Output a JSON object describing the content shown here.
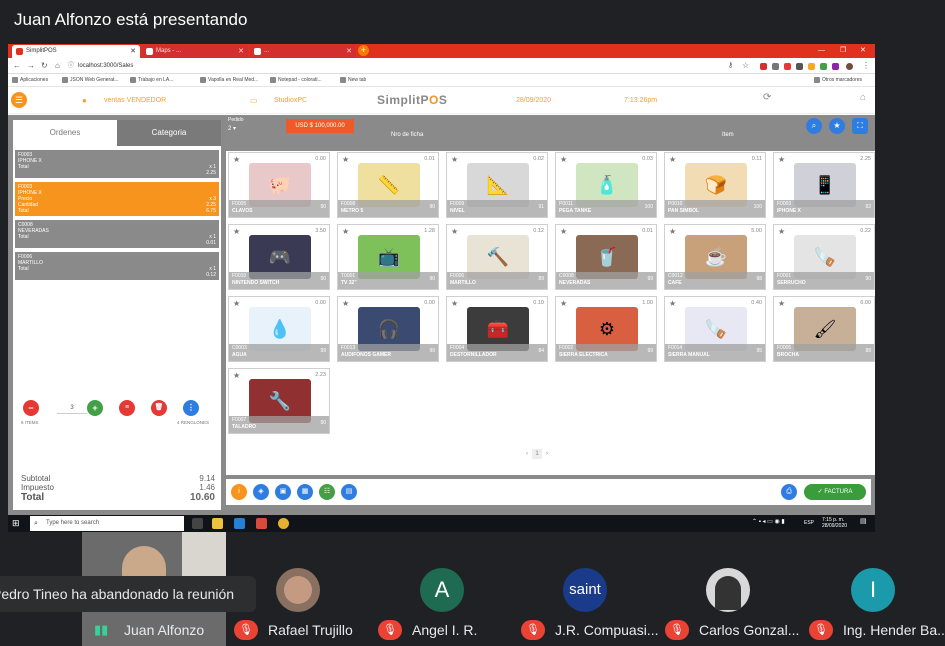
{
  "meet": {
    "presenting_title": "Juan Alfonzo está presentando",
    "notice": "Pedro Tineo ha abandonado la reunión",
    "participants": [
      {
        "name": "Juan Alfonzo",
        "muted": false
      },
      {
        "name": "Rafael Trujillo",
        "muted": true
      },
      {
        "name": "Angel I. R.",
        "muted": true,
        "initial": "A"
      },
      {
        "name": "J.R. Compuasi...",
        "muted": true,
        "initial": "saint"
      },
      {
        "name": "Carlos Gonzal...",
        "muted": true
      },
      {
        "name": "Ing. Hender Ba...",
        "muted": true,
        "initial": "I"
      }
    ]
  },
  "browser": {
    "tabs": [
      "SimplitPOS",
      "Maps - ...",
      "..."
    ],
    "url": "localhost:3000/Sales",
    "bookmarks": [
      "Aplicaciones",
      "JSON Web Generat...",
      "Trabajo en LA...",
      "Vapolla en Real Med...",
      "Notepad - colorati...",
      "New tab",
      "Otros marcadores"
    ]
  },
  "header": {
    "user": "ventas VENDEDOR",
    "station": "StudioxPC",
    "brand_pre": "SimplitP",
    "brand_o": "O",
    "brand_post": "S",
    "date": "28/09/2020",
    "time": "7:13:26pm"
  },
  "left": {
    "tabs": [
      "Ordenes",
      "Categoria"
    ],
    "orders": [
      {
        "code": "F0003",
        "name": "IPHONE X",
        "l1": "Total",
        "q": "x 1",
        "v": "2.25",
        "active": false
      },
      {
        "code": "F0003",
        "name": "IPHONE X",
        "l1": "Precio",
        "q": "x 3",
        "v": "2.25",
        "l2": "Cantidad",
        "l3": "Total",
        "v3": "6.75",
        "active": true
      },
      {
        "code": "C0008",
        "name": "NEVERADAS",
        "l1": "Total",
        "q": "x 1",
        "v": "0.01",
        "active": false
      },
      {
        "code": "F0006",
        "name": "MARTILLO",
        "l1": "Total",
        "q": "x 1",
        "v": "0.12",
        "active": false
      }
    ],
    "qty": "3",
    "items_label": "6 ITEMS",
    "renglones_label": "4 RENGLONES",
    "totals": {
      "subtotal_label": "Subtotal",
      "subtotal": "9.14",
      "impuesto_label": "Impuesto",
      "impuesto": "1.46",
      "total_label": "Total",
      "total": "10.60"
    }
  },
  "top": {
    "pedido_label": "Pedido",
    "pedido_val": "2",
    "usd": "USD $ 100,000.00",
    "ficha_label": "Nro de ficha",
    "item_label": "Item"
  },
  "products": [
    {
      "code": "F0005",
      "name": "CLAVOS",
      "price": "0.00",
      "stock": "90",
      "emoji": "🐖",
      "bg": "#e8c8c8"
    },
    {
      "code": "F0008",
      "name": "METRO 5",
      "price": "0.01",
      "stock": "90",
      "emoji": "📏",
      "bg": "#f0e0a0"
    },
    {
      "code": "F0009",
      "name": "NIVEL",
      "price": "0.02",
      "stock": "91",
      "emoji": "📐",
      "bg": "#d8d8d8"
    },
    {
      "code": "P0011",
      "name": "PEGA TANKE",
      "price": "0.03",
      "stock": "100",
      "emoji": "🧴",
      "bg": "#cfe6c0"
    },
    {
      "code": "P0010",
      "name": "PAN SIMBOL",
      "price": "0.11",
      "stock": "100",
      "emoji": "🍞",
      "bg": "#f1dcb4"
    },
    {
      "code": "F0003",
      "name": "IPHONE X",
      "price": "2.25",
      "stock": "92",
      "emoji": "📱",
      "bg": "#d0d0d8"
    },
    {
      "code": "F0010",
      "name": "NINTENDO SWITCH",
      "price": "3.50",
      "stock": "90",
      "emoji": "🎮",
      "bg": "#3a3a55"
    },
    {
      "code": "T0001",
      "name": "TV 32\"",
      "price": "1.28",
      "stock": "90",
      "emoji": "📺",
      "bg": "#7ec05a"
    },
    {
      "code": "F0006",
      "name": "MARTILLO",
      "price": "0.12",
      "stock": "89",
      "emoji": "🔨",
      "bg": "#e9e3d6"
    },
    {
      "code": "C0008",
      "name": "NEVERADAS",
      "price": "0.01",
      "stock": "99",
      "emoji": "🥤",
      "bg": "#8a6a55"
    },
    {
      "code": "C0012",
      "name": "CAFE",
      "price": "5.00",
      "stock": "98",
      "emoji": "☕",
      "bg": "#c8a07a"
    },
    {
      "code": "F0001",
      "name": "SERRUCHO",
      "price": "0.22",
      "stock": "90",
      "emoji": "🪚",
      "bg": "#e4e4e4"
    },
    {
      "code": "C0003",
      "name": "AGUA",
      "price": "0.00",
      "stock": "99",
      "emoji": "💧",
      "bg": "#e8f2fb"
    },
    {
      "code": "F0013",
      "name": "AUDIFONOS GAMER",
      "price": "0.00",
      "stock": "99",
      "emoji": "🎧",
      "bg": "#3a4a70"
    },
    {
      "code": "F0004",
      "name": "DESTORNILLADOR",
      "price": "0.10",
      "stock": "84",
      "emoji": "🧰",
      "bg": "#3c3c3c"
    },
    {
      "code": "F0002",
      "name": "SIERRA ELECTRICA",
      "price": "1.00",
      "stock": "99",
      "emoji": "⚙",
      "bg": "#d86040"
    },
    {
      "code": "F0014",
      "name": "SIERRA MANUAL",
      "price": "0.40",
      "stock": "95",
      "emoji": "🪚",
      "bg": "#e8e8f4"
    },
    {
      "code": "F0005",
      "name": "BROCHA",
      "price": "6.00",
      "stock": "88",
      "emoji": "🖌",
      "bg": "#c8b098"
    },
    {
      "code": "F0007",
      "name": "TALADRO",
      "price": "2.23",
      "stock": "90",
      "emoji": "🔧",
      "bg": "#903030"
    }
  ],
  "pager": {
    "page": "1"
  },
  "bottom": {
    "factura": "✓ FACTURA"
  },
  "taskbar": {
    "search_placeholder": "Type here to search",
    "tray_time": "7:15 p. m.",
    "tray_date": "28/09/2020",
    "lang": "ESP"
  },
  "colors": {
    "accent": "#f7941d",
    "danger": "#e53935",
    "primary": "#2f7de1",
    "success": "#3b9c3b"
  }
}
